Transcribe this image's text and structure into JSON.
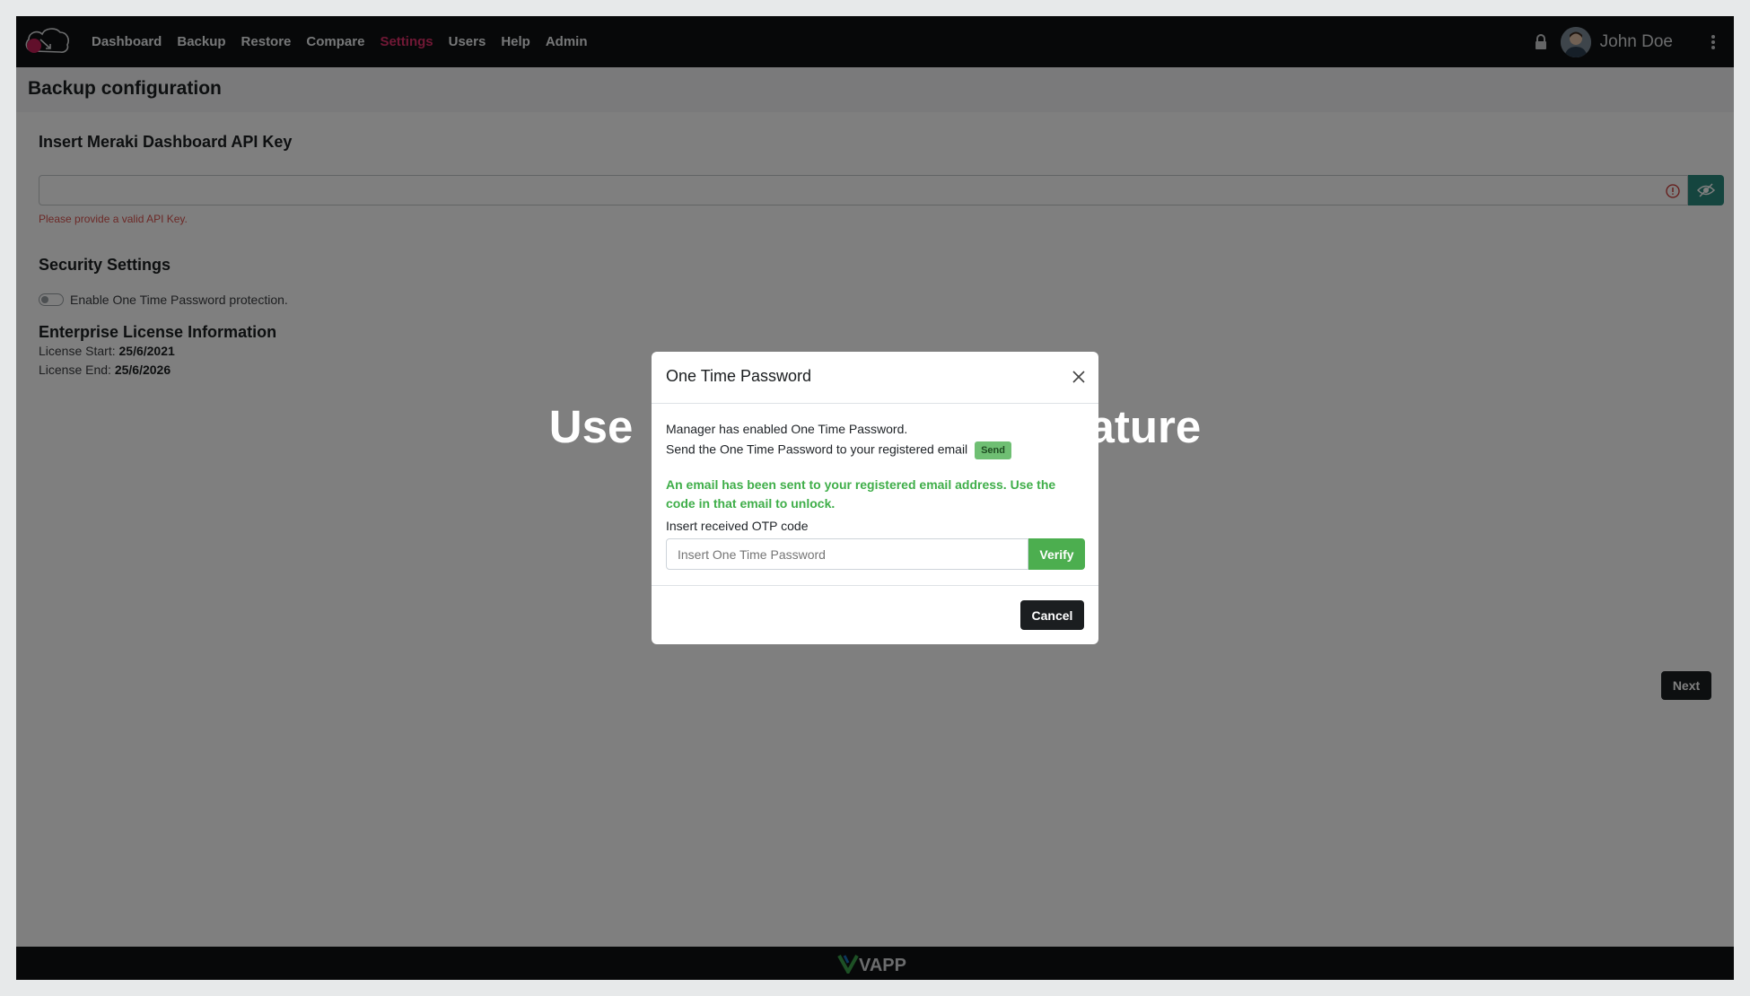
{
  "nav": {
    "links": [
      "Dashboard",
      "Backup",
      "Restore",
      "Compare",
      "Settings",
      "Users",
      "Help",
      "Admin"
    ],
    "active": "Settings",
    "user_name": "John Doe"
  },
  "page": {
    "title": "Backup configuration",
    "api_key_title": "Insert Meraki Dashboard API Key",
    "api_key_error": "Please provide a valid API Key.",
    "security_title": "Security Settings",
    "otp_toggle_label": "Enable One Time Password protection.",
    "license_title": "Enterprise License Information",
    "license_start_label": "License Start:",
    "license_start_value": "25/6/2021",
    "license_end_label": "License End:",
    "license_end_value": "25/6/2026",
    "next_label": "Next"
  },
  "overlay": {
    "promo_left": "Use ",
    "promo_right": "ature"
  },
  "modal": {
    "title": "One Time Password",
    "line1": "Manager has enabled One Time Password.",
    "line2": "Send the One Time Password to your registered email",
    "send_label": "Send",
    "success": "An email has been sent to your registered email address. Use the code in that email to unlock.",
    "otp_label": "Insert received OTP code",
    "otp_placeholder": "Insert One Time Password",
    "verify_label": "Verify",
    "cancel_label": "Cancel"
  },
  "footer": {
    "brand": "VAPP"
  },
  "colors": {
    "active_nav": "#e0306a",
    "success": "#3fae49",
    "navbar": "#0f1112"
  }
}
